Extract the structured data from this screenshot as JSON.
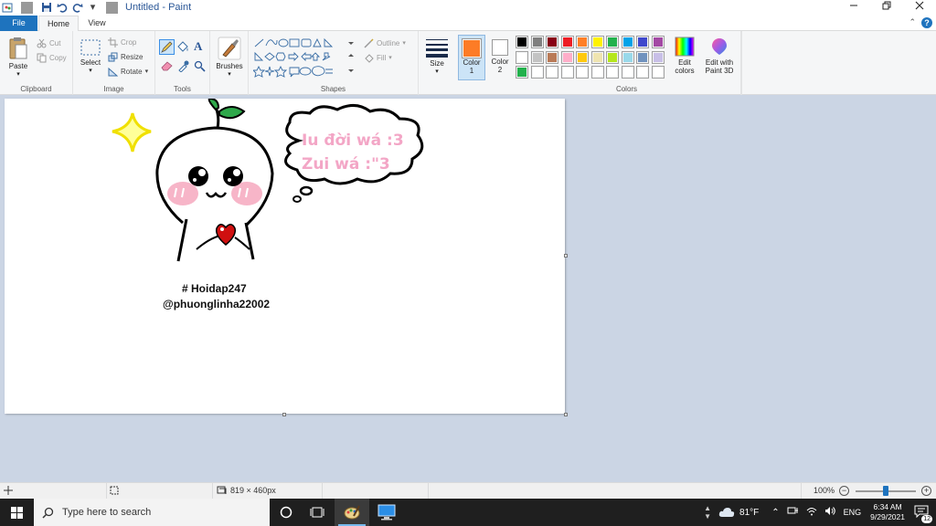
{
  "window": {
    "title": "Untitled - Paint",
    "qa_dropdown": "▾"
  },
  "tabs": {
    "file": "File",
    "home": "Home",
    "view": "View"
  },
  "ribbon": {
    "clipboard": {
      "label": "Clipboard",
      "paste": "Paste",
      "cut": "Cut",
      "copy": "Copy"
    },
    "image": {
      "label": "Image",
      "select": "Select",
      "crop": "Crop",
      "resize": "Resize",
      "rotate": "Rotate"
    },
    "tools": {
      "label": "Tools"
    },
    "brushes": {
      "label": "Brushes"
    },
    "shapes": {
      "label": "Shapes",
      "outline": "Outline",
      "fill": "Fill"
    },
    "size": {
      "label": "Size"
    },
    "color1": {
      "label": "Color",
      "num": "1",
      "value": "#fd7c26"
    },
    "color2": {
      "label": "Color",
      "num": "2",
      "value": "#ffffff"
    },
    "colors": {
      "label": "Colors"
    },
    "edit_colors": {
      "line1": "Edit",
      "line2": "colors"
    },
    "paint3d": {
      "line1": "Edit with",
      "line2": "Paint 3D"
    },
    "palette_row1": [
      "#000000",
      "#7f7f7f",
      "#880015",
      "#ed1c24",
      "#ff7f27",
      "#fff200",
      "#22b14c",
      "#00a2e8",
      "#3f48cc",
      "#a349a4"
    ],
    "palette_row2": [
      "#ffffff",
      "#c3c3c3",
      "#b97a57",
      "#ffaec9",
      "#ffc90e",
      "#efe4b0",
      "#b5e61d",
      "#99d9ea",
      "#7092be",
      "#c8bfe7"
    ],
    "palette_row3": [
      "#22b14c",
      "#ffffff",
      "#ffffff",
      "#ffffff",
      "#ffffff",
      "#ffffff",
      "#ffffff",
      "#ffffff",
      "#ffffff",
      "#ffffff"
    ]
  },
  "canvas": {
    "bubble_line1": "Iu đời wá :3",
    "bubble_line2": "Zui wá :\"3",
    "caption_line1": "# Hoidap247",
    "caption_line2": "@phuonglinha22002",
    "bubble_text_color": "#f3a6c6"
  },
  "status": {
    "dimensions": "819 × 460px",
    "zoom": "100%"
  },
  "taskbar": {
    "search_placeholder": "Type here to search",
    "weather": "81°F",
    "lang": "ENG",
    "time": "6:34 AM",
    "date": "9/29/2021",
    "notifications": "12"
  }
}
